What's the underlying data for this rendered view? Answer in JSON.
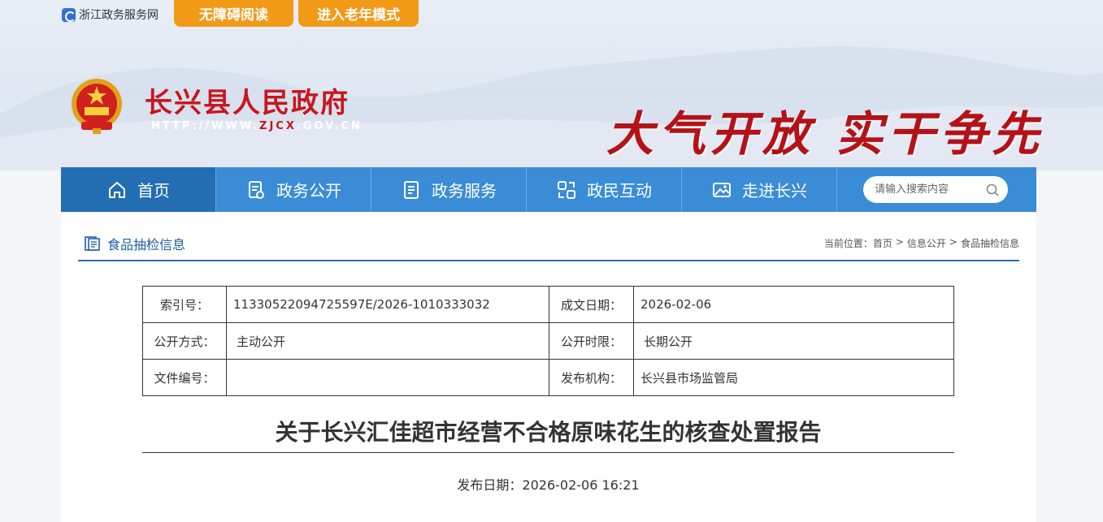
{
  "topbar": {
    "portal_label": "浙江政务服务网",
    "accessible_label": "无障碍阅读",
    "elder_mode_label": "进入老年模式"
  },
  "header": {
    "title": "长兴县人民政府",
    "url_prefix": "HTTP://WWW.",
    "url_highlight": "ZJCX",
    "url_suffix": ".GOV.CN",
    "slogan": "大气开放 实干争先"
  },
  "nav": {
    "items": [
      {
        "label": "首页",
        "icon": "home-icon"
      },
      {
        "label": "政务公开",
        "icon": "document-icon"
      },
      {
        "label": "政务服务",
        "icon": "service-icon"
      },
      {
        "label": "政民互动",
        "icon": "interact-icon"
      },
      {
        "label": "走进长兴",
        "icon": "image-icon"
      }
    ],
    "search_placeholder": "请输入搜索内容"
  },
  "section": {
    "title": "食品抽检信息",
    "breadcrumb_prefix": "当前位置：",
    "crumbs": [
      "首页",
      "信息公开",
      "食品抽检信息"
    ],
    "separator": ">"
  },
  "meta": {
    "index_label": "索引号：",
    "index_value": "11330522094725597E/2026-1010333032",
    "date_label": "成文日期：",
    "date_value": "2026-02-06",
    "method_label": "公开方式：",
    "method_value": "主动公开",
    "period_label": "公开时限：",
    "period_value": "长期公开",
    "docno_label": "文件编号：",
    "docno_value": "",
    "org_label": "发布机构：",
    "org_value": "长兴县市场监管局"
  },
  "article": {
    "title": "关于长兴汇佳超市经营不合格原味花生的核查处置报告",
    "pubdate": "发布日期：2026-02-06 16:21"
  },
  "colors": {
    "nav_bg": "#3b8cd6",
    "nav_active": "#236db3",
    "accent_orange": "#f29a17",
    "brand_red": "#c8161d"
  }
}
